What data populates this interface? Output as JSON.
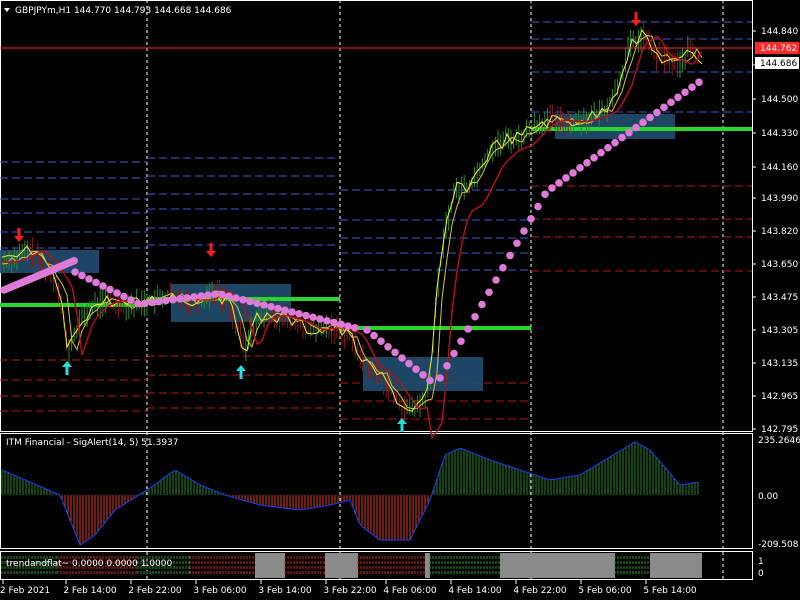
{
  "header": {
    "symbol_line": "GBPJPYm,H1  144.770 144.793 144.668 144.686"
  },
  "price_axis": {
    "ticks": [
      "144.840",
      "144.675",
      "144.500",
      "144.330",
      "144.160",
      "143.990",
      "143.820",
      "143.650",
      "143.475",
      "143.305",
      "143.135",
      "142.965",
      "142.795"
    ],
    "badge_red": "144.762",
    "badge_white": "144.686"
  },
  "indicator": {
    "title": "ITM Financial - SigAlert(14, 5) 51.3937",
    "ticks": [
      "235.2646",
      "0.00",
      "-209.508"
    ]
  },
  "strip": {
    "title": "trendandflat~ 0.0000 0.0000 1.0000",
    "ticks": [
      "1",
      "0"
    ]
  },
  "time_axis": {
    "labels": [
      "2 Feb 2021",
      "2 Feb 14:00",
      "2 Feb 22:00",
      "3 Feb 06:00",
      "3 Feb 14:00",
      "3 Feb 22:00",
      "4 Feb 06:00",
      "4 Feb 14:00",
      "4 Feb 22:00",
      "5 Feb 06:00",
      "5 Feb 14:00"
    ]
  },
  "colors": {
    "background": "#000000",
    "grid": "#ffffff",
    "price_line": "#ff2a2a",
    "green_level": "#2bd62b",
    "dots": "#e07ad8",
    "yellow": "#f2f23a",
    "dark_red_ma": "#b0101a",
    "box": "#1f4e6e",
    "up_arrow": "#22e0e0",
    "down_arrow": "#ff1a1a",
    "hist_up": "#1f8a1f",
    "hist_down": "#e03a1f",
    "sig_line": "#1a3bd6",
    "strip_gray": "#8a8a8a"
  }
}
